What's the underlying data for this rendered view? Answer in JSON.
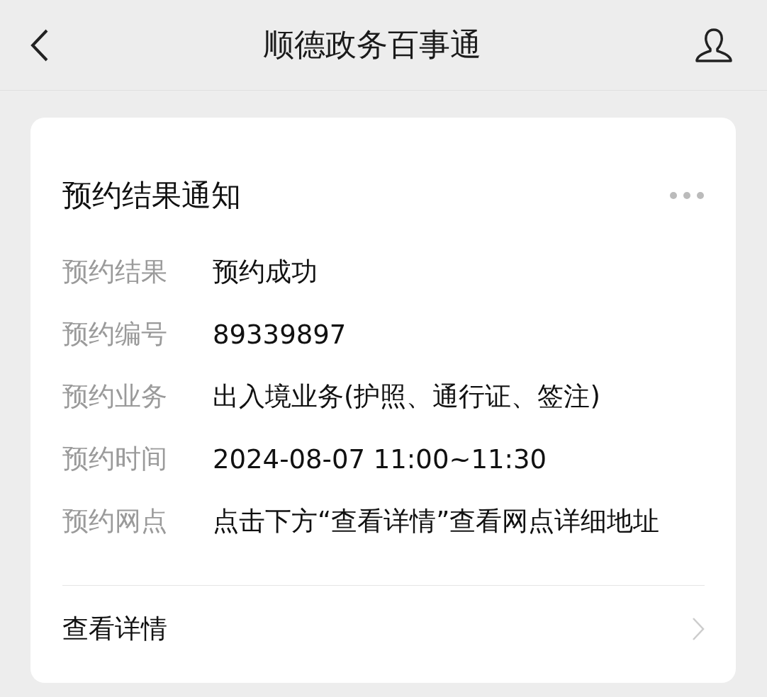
{
  "header": {
    "title": "顺德政务百事通"
  },
  "card": {
    "title": "预约结果通知",
    "rows": [
      {
        "label": "预约结果",
        "value": "预约成功"
      },
      {
        "label": "预约编号",
        "value": "89339897"
      },
      {
        "label": "预约业务",
        "value": "出入境业务(护照、通行证、签注)"
      },
      {
        "label": "预约时间",
        "value": "2024-08-07 11:00~11:30"
      },
      {
        "label": "预约网点",
        "value": "点击下方“查看详情”查看网点详细地址"
      }
    ],
    "link": "查看详情"
  }
}
